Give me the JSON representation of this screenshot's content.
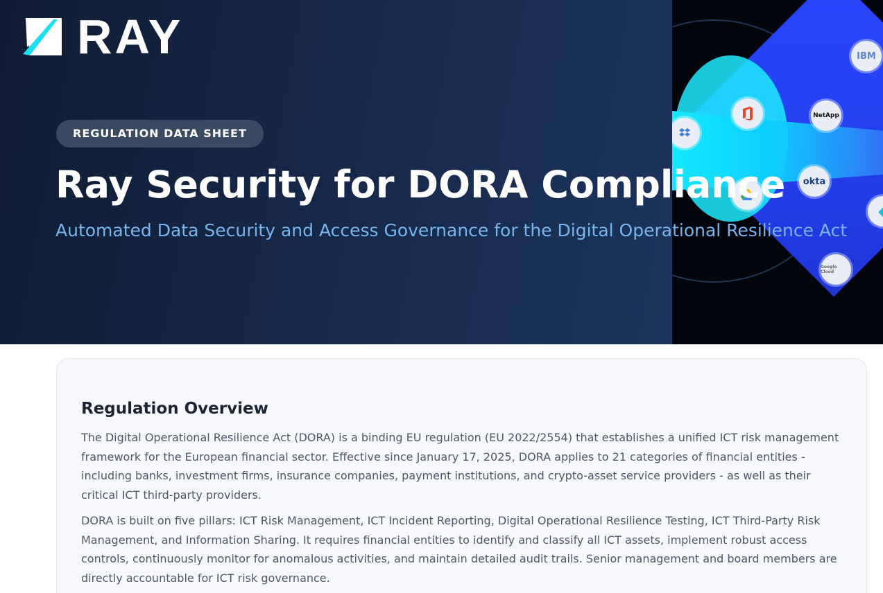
{
  "brand": {
    "name": "RAY",
    "colors": {
      "accent_cyan": "#16e8ff",
      "hero_bg": "#17294a",
      "subtitle": "#7ab4ee"
    }
  },
  "hero": {
    "badge": "REGULATION DATA SHEET",
    "title": "Ray Security for DORA Compliance",
    "subtitle": "Automated Data Security and Access Governance for the Digital Operational Resilience Act",
    "integrations": [
      {
        "name": "IBM",
        "icon": "ibm-icon"
      },
      {
        "name": "Microsoft Office",
        "icon": "office-icon"
      },
      {
        "name": "NetApp",
        "icon": "netapp-icon"
      },
      {
        "name": "Dropbox",
        "icon": "dropbox-icon"
      },
      {
        "name": "okta",
        "icon": "okta-icon"
      },
      {
        "name": "Google Drive",
        "icon": "google-drive-icon"
      },
      {
        "name": "Google Cloud",
        "icon": "google-cloud-icon"
      },
      {
        "name": "Integration",
        "icon": "integration-icon"
      }
    ]
  },
  "overview": {
    "title": "Regulation Overview",
    "paragraphs": [
      "The Digital Operational Resilience Act (DORA) is a binding EU regulation (EU 2022/2554) that establishes a unified ICT risk management framework for the European financial sector. Effective since January 17, 2025, DORA applies to 21 categories of financial entities - including banks, investment firms, insurance companies, payment institutions, and crypto-asset service providers - as well as their critical ICT third-party providers.",
      "DORA is built on five pillars: ICT Risk Management, ICT Incident Reporting, Digital Operational Resilience Testing, ICT Third-Party Risk Management, and Information Sharing. It requires financial entities to identify and classify all ICT assets, implement robust access controls, continuously monitor for anomalous activities, and maintain detailed audit trails. Senior management and board members are directly accountable for ICT risk governance."
    ]
  }
}
